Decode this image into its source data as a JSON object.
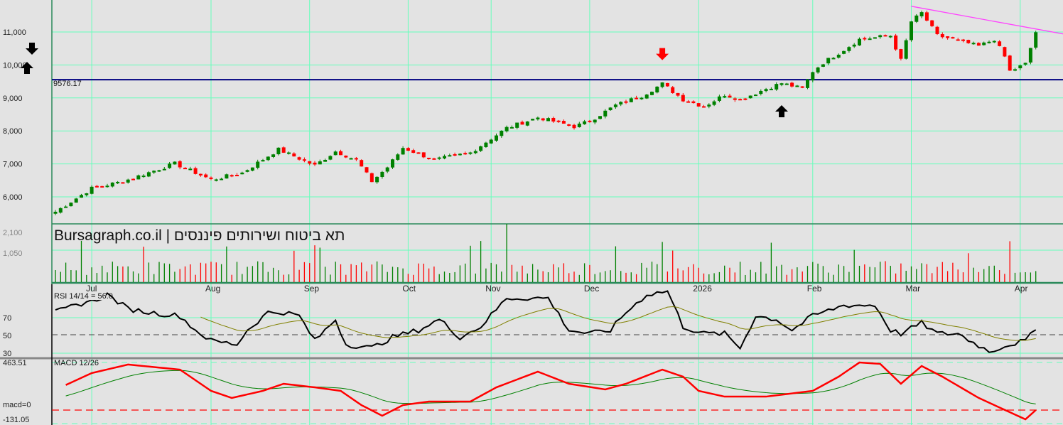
{
  "chart_data": [
    {
      "type": "candlestick",
      "title": "Bursagraph.co.il | תא ביטוח ושירותים פיננסים",
      "x_unit": "bar index",
      "yticks": [
        "11,000",
        "10,000",
        "9,000",
        "8,000",
        "7,000",
        "6,000"
      ],
      "ytick_values": [
        11000,
        10000,
        9000,
        8000,
        7000,
        6000
      ],
      "ylim": [
        5000,
        11800
      ],
      "months": [
        {
          "label": "Jul",
          "bar": 7
        },
        {
          "label": "Aug",
          "bar": 30
        },
        {
          "label": "Sep",
          "bar": 49
        },
        {
          "label": "Oct",
          "bar": 68
        },
        {
          "label": "Nov",
          "bar": 84
        },
        {
          "label": "Dec",
          "bar": 103
        },
        {
          "label": "2026",
          "bar": 124
        },
        {
          "label": "Feb",
          "bar": 146
        },
        {
          "label": "Mar",
          "bar": 165
        },
        {
          "label": "Apr",
          "bar": 186
        }
      ],
      "close_anchors": [
        [
          0,
          5550
        ],
        [
          7,
          6260
        ],
        [
          13,
          6470
        ],
        [
          23,
          7010
        ],
        [
          30,
          6520
        ],
        [
          36,
          6730
        ],
        [
          43,
          7440
        ],
        [
          50,
          6950
        ],
        [
          54,
          7380
        ],
        [
          58,
          7120
        ],
        [
          61,
          6470
        ],
        [
          64,
          6900
        ],
        [
          67,
          7490
        ],
        [
          73,
          7120
        ],
        [
          80,
          7340
        ],
        [
          87,
          8090
        ],
        [
          93,
          8410
        ],
        [
          100,
          8130
        ],
        [
          103,
          8300
        ],
        [
          108,
          8780
        ],
        [
          113,
          9060
        ],
        [
          117,
          9430
        ],
        [
          121,
          8950
        ],
        [
          125,
          8740
        ],
        [
          129,
          9100
        ],
        [
          132,
          8950
        ],
        [
          137,
          9280
        ],
        [
          140,
          9450
        ],
        [
          144,
          9280
        ],
        [
          146,
          9810
        ],
        [
          148,
          10070
        ],
        [
          152,
          10460
        ],
        [
          155,
          10780
        ],
        [
          161,
          10890
        ],
        [
          163,
          10140
        ],
        [
          165,
          11320
        ],
        [
          167,
          11580
        ],
        [
          170,
          10890
        ],
        [
          173,
          10780
        ],
        [
          178,
          10570
        ],
        [
          181,
          10780
        ],
        [
          183,
          10250
        ],
        [
          184,
          9810
        ],
        [
          187,
          10030
        ],
        [
          189,
          11000
        ]
      ],
      "support_line": {
        "value": 9576.17,
        "label": "9576.17"
      },
      "trendline": [
        [
          165,
          11780
        ],
        [
          195,
          10920
        ]
      ],
      "signals": [
        {
          "type": "down",
          "color": "#ff0000",
          "bar": 117
        },
        {
          "type": "up",
          "color": "#000000",
          "bar": 140
        }
      ],
      "colors": {
        "up": "#008000",
        "down": "#ff0000",
        "grid": "#66ffbb",
        "support": "#000080",
        "trend": "#ff44ff"
      }
    },
    {
      "type": "bar",
      "title": "Volume",
      "yticks": [
        "2,100",
        "1,050"
      ],
      "ytick_values": [
        2100,
        1050
      ]
    },
    {
      "type": "line",
      "title": "RSI 14/14 = 56.0",
      "yticks": [
        "70",
        "50",
        "30"
      ],
      "ytick_values": [
        70,
        50,
        30
      ],
      "ylim": [
        30,
        100
      ],
      "anchors": [
        [
          0,
          76
        ],
        [
          2,
          80
        ],
        [
          6,
          88
        ],
        [
          7,
          88
        ],
        [
          10,
          96
        ],
        [
          14,
          80
        ],
        [
          18,
          76
        ],
        [
          24,
          72
        ],
        [
          27,
          56
        ],
        [
          30,
          44
        ],
        [
          35,
          40
        ],
        [
          37,
          56
        ],
        [
          41,
          76
        ],
        [
          44,
          76
        ],
        [
          47,
          72
        ],
        [
          50,
          44
        ],
        [
          54,
          68
        ],
        [
          56,
          40
        ],
        [
          61,
          36
        ],
        [
          65,
          48
        ],
        [
          70,
          56
        ],
        [
          74,
          68
        ],
        [
          78,
          48
        ],
        [
          82,
          60
        ],
        [
          87,
          92
        ],
        [
          91,
          92
        ],
        [
          95,
          92
        ],
        [
          99,
          56
        ],
        [
          103,
          52
        ],
        [
          107,
          56
        ],
        [
          110,
          76
        ],
        [
          114,
          96
        ],
        [
          118,
          100
        ],
        [
          121,
          60
        ],
        [
          125,
          52
        ],
        [
          129,
          52
        ],
        [
          132,
          36
        ],
        [
          135,
          72
        ],
        [
          139,
          68
        ],
        [
          142,
          56
        ],
        [
          146,
          72
        ],
        [
          152,
          84
        ],
        [
          158,
          84
        ],
        [
          161,
          56
        ],
        [
          163,
          52
        ],
        [
          167,
          64
        ],
        [
          170,
          52
        ],
        [
          174,
          52
        ],
        [
          180,
          32
        ],
        [
          184,
          40
        ],
        [
          187,
          44
        ],
        [
          189,
          56
        ]
      ]
    },
    {
      "type": "line",
      "title": "MACD 12/26",
      "yticks": [
        "463.51",
        "macd=0",
        "-131.05"
      ],
      "ylim": [
        -131.05,
        463.51
      ],
      "anchors": [
        [
          1,
          221
        ],
        [
          7,
          360
        ],
        [
          14,
          443
        ],
        [
          24,
          394
        ],
        [
          30,
          187
        ],
        [
          34,
          118
        ],
        [
          40,
          187
        ],
        [
          44,
          256
        ],
        [
          50,
          221
        ],
        [
          55,
          187
        ],
        [
          59,
          48
        ],
        [
          63,
          -55
        ],
        [
          67,
          48
        ],
        [
          72,
          83
        ],
        [
          80,
          83
        ],
        [
          85,
          221
        ],
        [
          93,
          374
        ],
        [
          99,
          256
        ],
        [
          106,
          201
        ],
        [
          110,
          256
        ],
        [
          117,
          394
        ],
        [
          121,
          325
        ],
        [
          124,
          187
        ],
        [
          129,
          131
        ],
        [
          137,
          131
        ],
        [
          146,
          187
        ],
        [
          151,
          325
        ],
        [
          155,
          463
        ],
        [
          159,
          450
        ],
        [
          163,
          256
        ],
        [
          167,
          429
        ],
        [
          171,
          325
        ],
        [
          178,
          118
        ],
        [
          184,
          -21
        ],
        [
          187,
          -90
        ],
        [
          189,
          0
        ]
      ]
    }
  ]
}
